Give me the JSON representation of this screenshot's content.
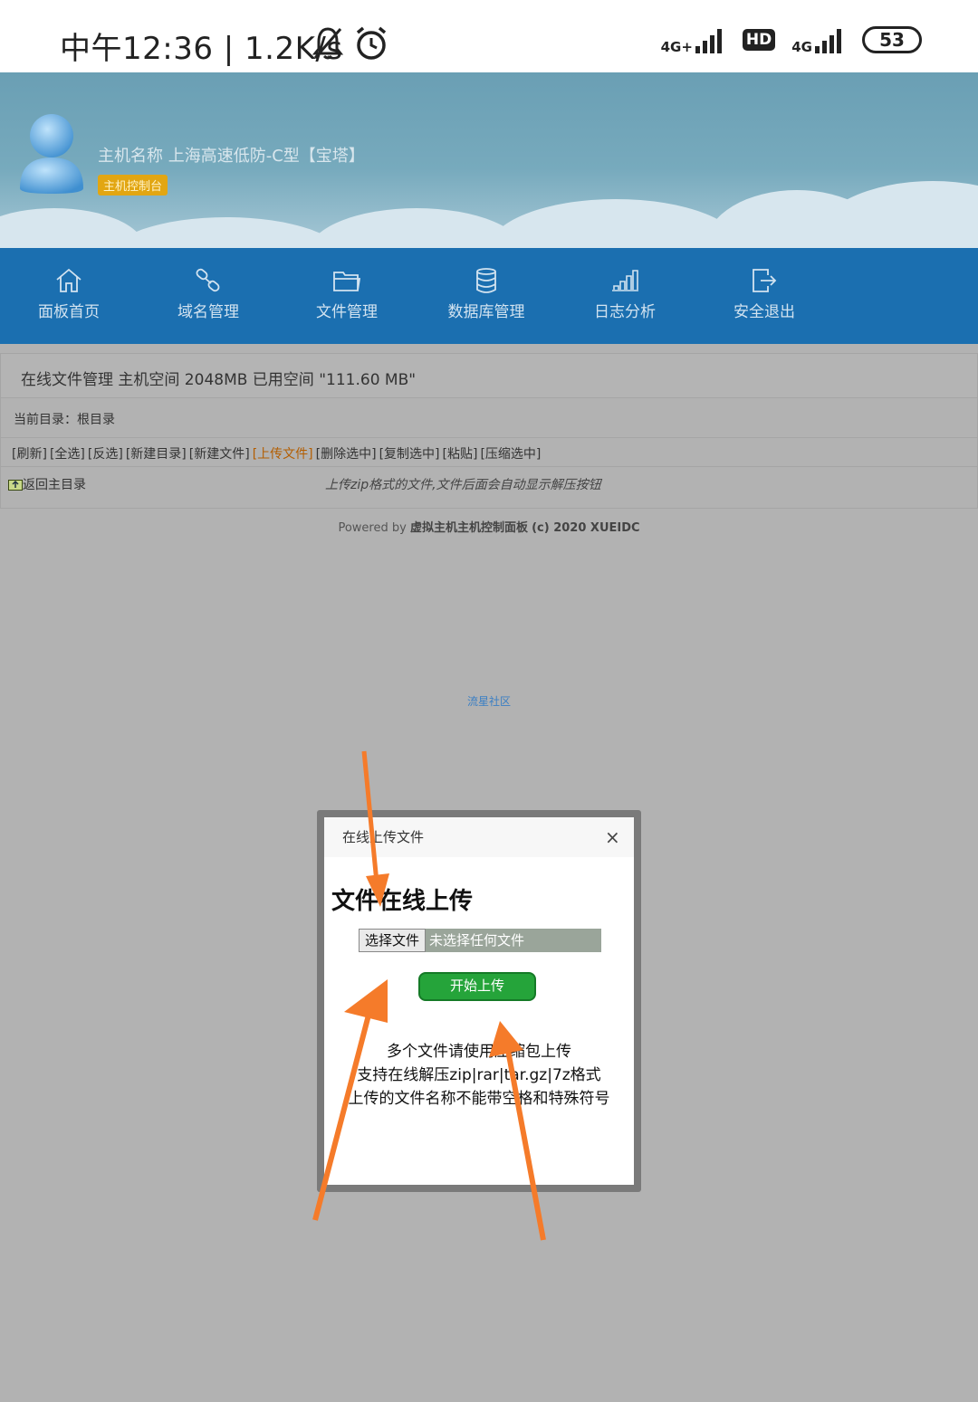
{
  "status_bar": {
    "time": "中午12:36 | 1.2K/s",
    "net1": "4G+",
    "hd": "HD",
    "net2": "4G",
    "battery": "53"
  },
  "header": {
    "host_title": "主机名称 上海高速低防-C型【宝塔】",
    "badge": "主机控制台"
  },
  "nav": {
    "items": [
      {
        "label": "面板首页",
        "icon": "home-icon"
      },
      {
        "label": "域名管理",
        "icon": "link-icon"
      },
      {
        "label": "文件管理",
        "icon": "folder-icon"
      },
      {
        "label": "数据库管理",
        "icon": "database-icon"
      },
      {
        "label": "日志分析",
        "icon": "bar-chart-icon"
      },
      {
        "label": "安全退出",
        "icon": "logout-icon"
      }
    ]
  },
  "file_manager": {
    "title": "在线文件管理 主机空间 2048MB 已用空间 \"111.60 MB\"",
    "current_dir": "当前目录：根目录",
    "tools": [
      "[刷新]",
      "[全选]",
      "[反选]",
      "[新建目录]",
      "[新建文件]",
      "[上传文件]",
      "[删除选中]",
      "[复制选中]",
      "[粘贴]",
      "[压缩选中]"
    ],
    "back_label": "返回主目录",
    "hint": "上传zip格式的文件,文件后面会自动显示解压按钮"
  },
  "footer": {
    "powered_prefix": "Powered by",
    "powered_name": "虚拟主机主机控制面板",
    "powered_suffix": "(c) 2020 XUEIDC",
    "community": "流星社区"
  },
  "dialog": {
    "title": "在线上传文件",
    "close": "×",
    "heading": "文件在线上传",
    "choose_file": "选择文件",
    "no_file": "未选择任何文件",
    "start_upload": "开始上传",
    "notes": [
      "多个文件请使用压缩包上传",
      "支持在线解压zip|rar|tar.gz|7z格式",
      "上传的文件名称不能带空格和特殊符号"
    ]
  },
  "colors": {
    "nav_bg": "#1b6fb0",
    "badge": "#e2a612",
    "upload_button": "#25a43a",
    "arrow": "#f57b2a"
  }
}
